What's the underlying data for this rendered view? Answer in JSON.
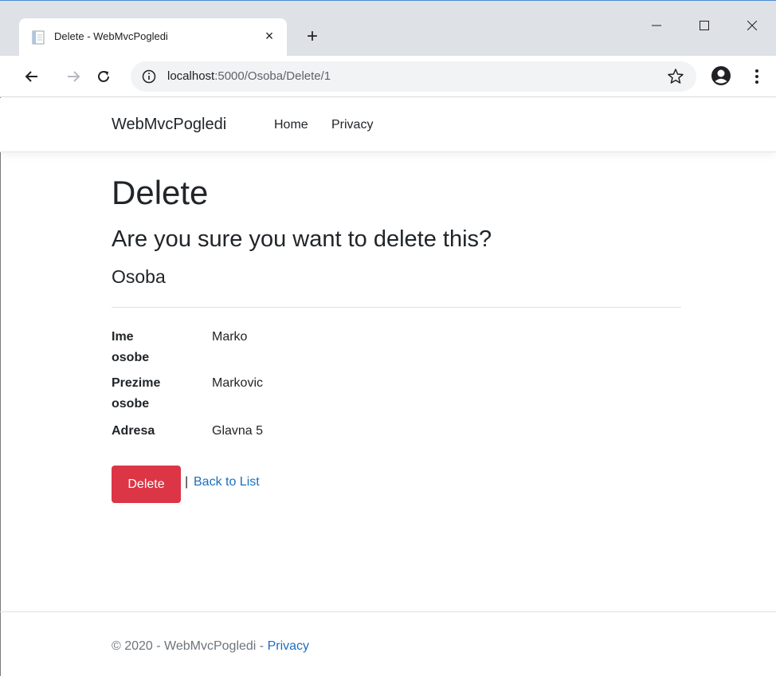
{
  "browser": {
    "tab_title": "Delete - WebMvcPogledi",
    "tab_close": "×",
    "new_tab": "+",
    "url_host": "localhost",
    "url_path": ":5000/Osoba/Delete/1",
    "icons": [
      "file-favicon-icon",
      "back-arrow-icon",
      "forward-arrow-icon",
      "reload-icon",
      "info-icon",
      "star-icon",
      "profile-icon",
      "kebab-menu-icon",
      "minimize-icon",
      "maximize-icon",
      "close-icon"
    ]
  },
  "navbar": {
    "brand": "WebMvcPogledi",
    "links": [
      {
        "label": "Home"
      },
      {
        "label": "Privacy"
      }
    ]
  },
  "main": {
    "title": "Delete",
    "question": "Are you sure you want to delete this?",
    "entity": "Osoba",
    "fields": [
      {
        "label_lines": [
          "Ime",
          "osobe"
        ],
        "value": "Marko"
      },
      {
        "label_lines": [
          "Prezime",
          "osobe"
        ],
        "value": "Markovic"
      },
      {
        "label_lines": [
          "Adresa"
        ],
        "value": "Glavna 5"
      }
    ],
    "delete_label": "Delete",
    "separator": "|",
    "back_label": "Back to List"
  },
  "footer": {
    "copyright": "© 2020 - WebMvcPogledi - ",
    "privacy_label": "Privacy"
  },
  "colors": {
    "danger": "#dc3545",
    "link": "#1b6ec2",
    "muted": "#6c757d",
    "chrome_bg": "#dee1e6"
  }
}
